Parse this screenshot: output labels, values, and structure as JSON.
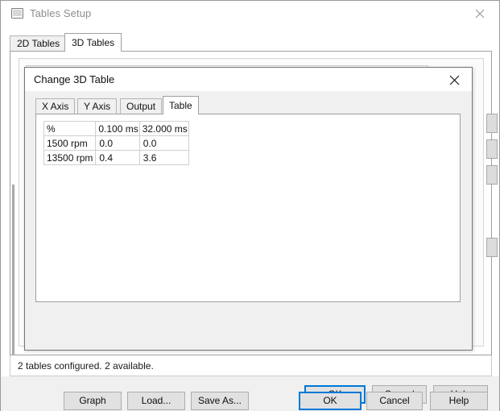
{
  "outer_window": {
    "title": "Tables Setup",
    "icon": "window-icon",
    "close_icon": "close-icon",
    "tabs": [
      {
        "label": "2D Tables",
        "active": false
      },
      {
        "label": "3D Tables",
        "active": true
      }
    ],
    "status_text": "2 tables configured. 2 available.",
    "buttons": {
      "ok": "OK",
      "cancel": "Cancel",
      "help": "Help"
    },
    "default_button": "OK",
    "accent_color": "#0078d7"
  },
  "inner_dialog": {
    "title": "Change 3D Table",
    "close_icon": "close-icon",
    "tabs": [
      {
        "label": "X Axis",
        "active": false
      },
      {
        "label": "Y Axis",
        "active": false
      },
      {
        "label": "Output",
        "active": false
      },
      {
        "label": "Table",
        "active": true
      }
    ],
    "buttons": {
      "graph": "Graph",
      "load": "Load...",
      "save_as": "Save As...",
      "ok": "OK",
      "cancel": "Cancel",
      "help": "Help"
    },
    "default_button": "OK",
    "accent_color": "#0078d7"
  },
  "chart_data": {
    "type": "table",
    "title": "3D Table",
    "corner_label": "%",
    "columns": [
      "0.100 ms",
      "32.000 ms"
    ],
    "rows": [
      "1500 rpm",
      "13500 rpm"
    ],
    "values": [
      [
        "0.0",
        "0.0"
      ],
      [
        "0.4",
        "3.6"
      ]
    ],
    "xlabel": "ms",
    "ylabel": "rpm"
  }
}
